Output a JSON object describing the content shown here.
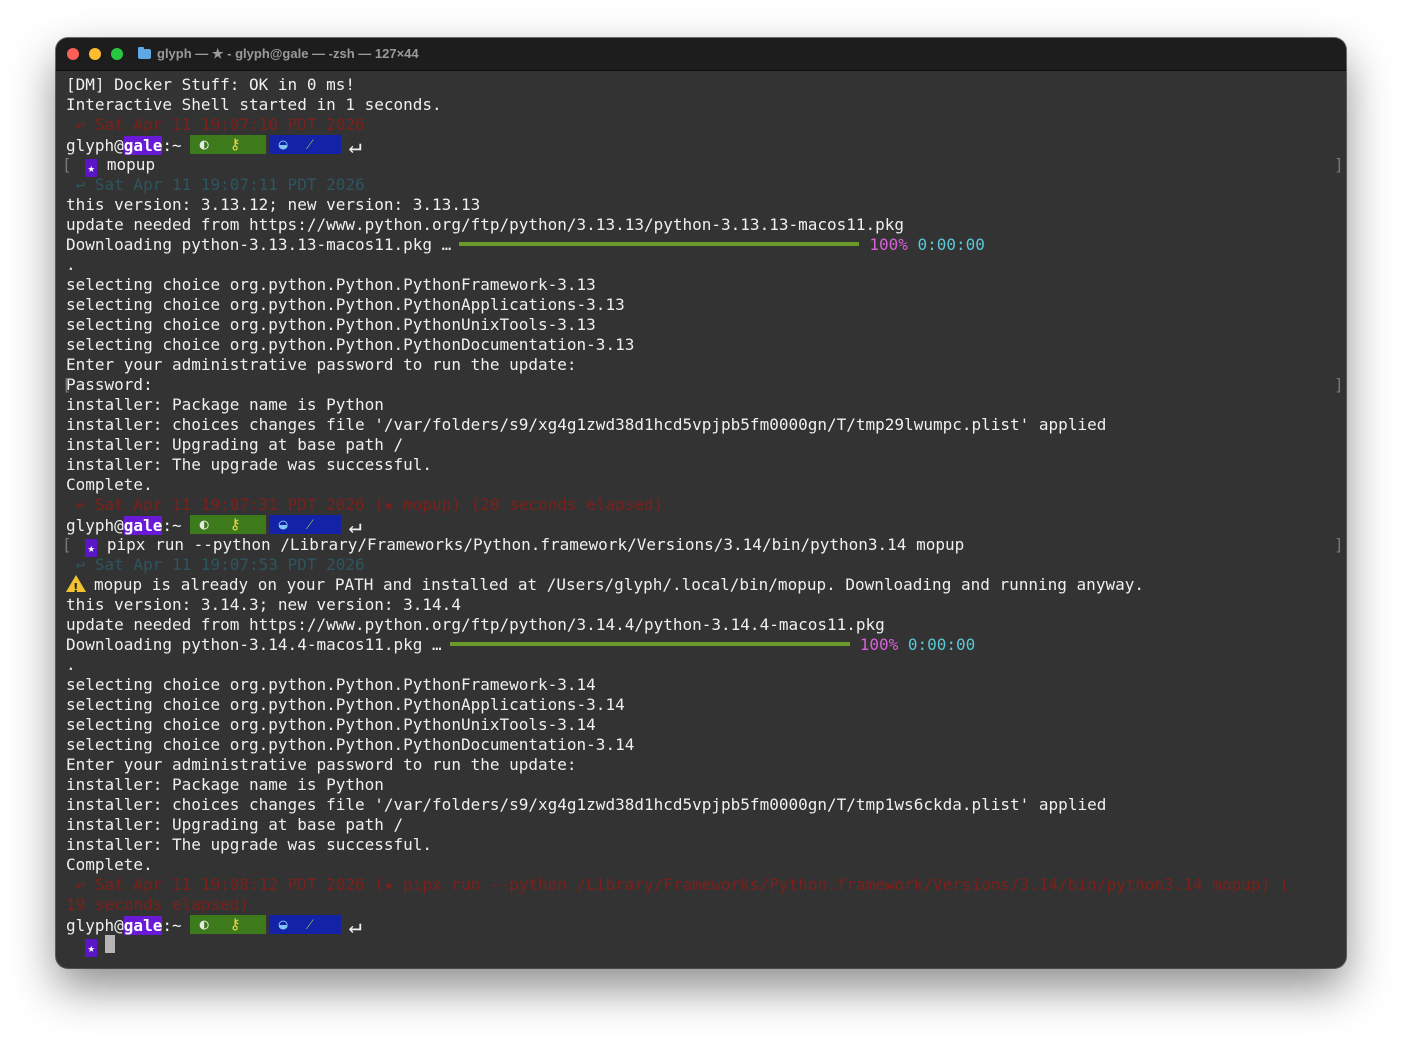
{
  "window": {
    "title": "glyph — ★ - glyph@gale — -zsh — 127×44"
  },
  "prompt": {
    "user": "glyph@",
    "host": "gale",
    "suffix": ":~",
    "star": "★",
    "segment_icons": [
      "shell-icon",
      "key-icon",
      "whale-icon",
      "pea-pod-icon"
    ]
  },
  "terminal": {
    "l01": "[DM] Docker Stuff: OK in 0 ms!",
    "l02": "Interactive Shell started in 1 seconds.",
    "l03": " ↩ Sat Apr 11 19:07:10 PDT 2026",
    "cmd1": "mopup",
    "l05": " ↩ Sat Apr 11 19:07:11 PDT 2026",
    "l06": "this version: 3.13.12; new version: 3.13.13",
    "l07": "update needed from https://www.python.org/ftp/python/3.13.13/python-3.13.13-macos11.pkg",
    "l08": "Downloading python-3.13.13-macos11.pkg …",
    "l08_pct": "100%",
    "l08_time": "0:00:00",
    "l09": ".",
    "l10": "selecting choice org.python.Python.PythonFramework-3.13",
    "l11": "selecting choice org.python.Python.PythonApplications-3.13",
    "l12": "selecting choice org.python.Python.PythonUnixTools-3.13",
    "l13": "selecting choice org.python.Python.PythonDocumentation-3.13",
    "l14": "Enter your administrative password to run the update:",
    "l15": "Password:",
    "l16": "installer: Package name is Python",
    "l17": "installer: choices changes file '/var/folders/s9/xg4g1zwd38d1hcd5vpjpb5fm0000gn/T/tmp29lwumpc.plist' applied",
    "l18": "installer: Upgrading at base path /",
    "l19": "installer: The upgrade was successful.",
    "l20": "Complete.",
    "l21": " ↩ Sat Apr 11 19:07:31 PDT 2026 (★ mopup) (20 seconds elapsed)",
    "cmd2": "pipx run --python /Library/Frameworks/Python.framework/Versions/3.14/bin/python3.14 mopup",
    "l23": " ↩ Sat Apr 11 19:07:53 PDT 2026",
    "l24": "mopup is already on your PATH and installed at /Users/glyph/.local/bin/mopup. Downloading and running anyway.",
    "l25": "this version: 3.14.3; new version: 3.14.4",
    "l26": "update needed from https://www.python.org/ftp/python/3.14.4/python-3.14.4-macos11.pkg",
    "l27": "Downloading python-3.14.4-macos11.pkg …",
    "l27_pct": "100%",
    "l27_time": "0:00:00",
    "l28": ".",
    "l29": "selecting choice org.python.Python.PythonFramework-3.14",
    "l30": "selecting choice org.python.Python.PythonApplications-3.14",
    "l31": "selecting choice org.python.Python.PythonUnixTools-3.14",
    "l32": "selecting choice org.python.Python.PythonDocumentation-3.14",
    "l33": "Enter your administrative password to run the update:",
    "l34": "installer: Package name is Python",
    "l35": "installer: choices changes file '/var/folders/s9/xg4g1zwd38d1hcd5vpjpb5fm0000gn/T/tmp1ws6ckda.plist' applied",
    "l36": "installer: Upgrading at base path /",
    "l37": "installer: The upgrade was successful.",
    "l38": "Complete.",
    "l39": " ↩ Sat Apr 11 19:08:12 PDT 2026 (★ pipx run --python /Library/Frameworks/Python.framework/Versions/3.14/bin/python3.14 mopup) (",
    "l40": "19 seconds elapsed)"
  },
  "progress": {
    "download1": 1.0,
    "download2": 1.0
  },
  "colors": {
    "background": "#333333",
    "host_bg": "#6a1ad6",
    "segment_green": "#3d7a1c",
    "segment_blue": "#1422a8",
    "progress_bar": "#6c9a2a",
    "percent": "#d560d8",
    "time": "#5bc6d6"
  }
}
